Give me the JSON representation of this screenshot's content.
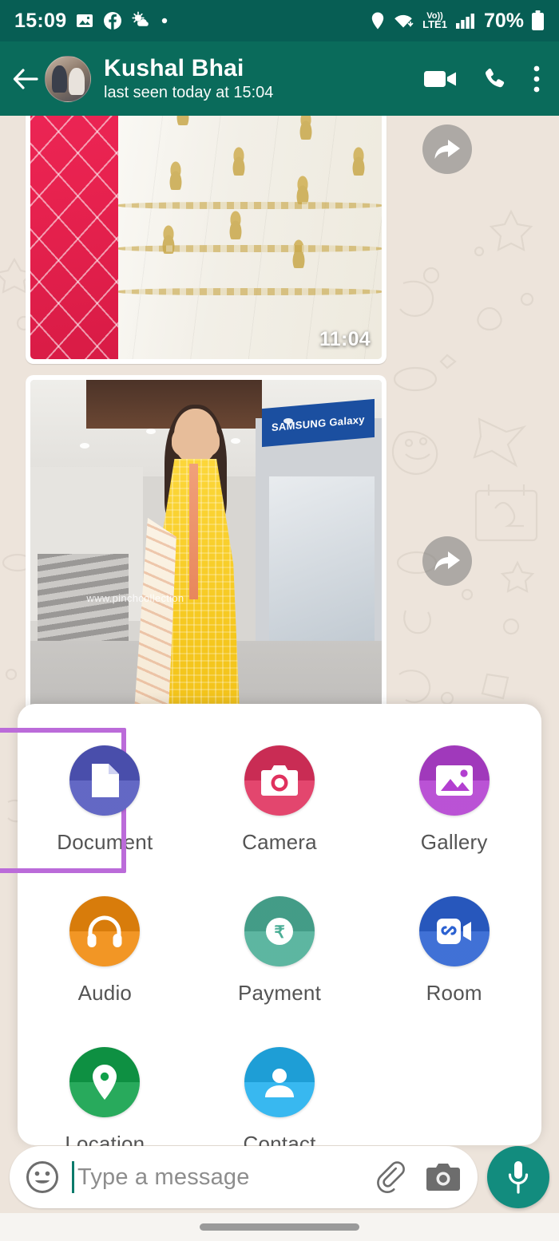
{
  "status_bar": {
    "time": "15:09",
    "battery": "70%",
    "network_label_top": "Vo))",
    "network_label_bottom": "LTE1",
    "icons": [
      "image-icon",
      "facebook-icon",
      "weather-icon",
      "dot-icon",
      "location-icon",
      "wifi-icon",
      "volte-icon",
      "signal-icon",
      "battery-icon"
    ]
  },
  "header": {
    "contact_name": "Kushal Bhai",
    "status_line": "last seen today at 15:04",
    "actions": [
      "video-call-icon",
      "voice-call-icon",
      "overflow-menu-icon"
    ]
  },
  "chat": {
    "messages": [
      {
        "type": "image",
        "description": "saree-textile-photo",
        "timestamp": "11:04",
        "has_forward": true
      },
      {
        "type": "image",
        "description": "woman-in-yellow-suit-photo",
        "watermark": "www.pinchcollection",
        "has_forward": true
      }
    ]
  },
  "attachment_panel": {
    "highlighted_item": "Document",
    "highlight_color": "#BB6BD9",
    "items": [
      {
        "label": "Document",
        "icon": "document-icon",
        "color": "#5157BE"
      },
      {
        "label": "Camera",
        "icon": "camera-icon",
        "color": "#E0315E"
      },
      {
        "label": "Gallery",
        "icon": "gallery-icon",
        "color": "#B23FD0"
      },
      {
        "label": "Audio",
        "icon": "headphones-icon",
        "color": "#F08A0C"
      },
      {
        "label": "Payment",
        "icon": "rupee-icon",
        "color": "#4BAE96"
      },
      {
        "label": "Room",
        "icon": "room-video-icon",
        "color": "#2B61D1"
      },
      {
        "label": "Location",
        "icon": "location-pin-icon",
        "color": "#10A04A"
      },
      {
        "label": "Contact",
        "icon": "person-icon",
        "color": "#21B0EE"
      }
    ]
  },
  "input_bar": {
    "placeholder": "Type a message",
    "emoji_icon": "emoji-icon",
    "attach_icon": "paperclip-icon",
    "camera_icon": "camera-icon",
    "mic_icon": "microphone-icon",
    "mic_color": "#128C7E"
  },
  "theme": {
    "status_bar_bg": "#075E54",
    "header_bg": "#0A6B5B",
    "chat_bg": "#EDE4DB"
  }
}
